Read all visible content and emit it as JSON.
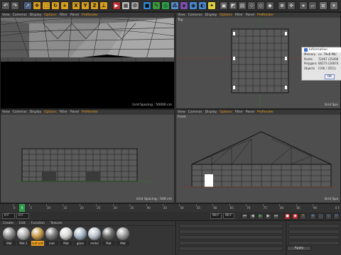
{
  "viewports": {
    "perspective": {
      "menus": [
        "View",
        "Cameras",
        "Display",
        "Options",
        "Filter",
        "Panel",
        "ProRender"
      ],
      "grid_spacing": "Grid Spacing : 50000 cm"
    },
    "top": {
      "menus": [
        "View",
        "Cameras",
        "Display",
        "Options",
        "Filter",
        "Panel",
        "ProRender"
      ],
      "name": "Top",
      "grid_spacing": "Grid Spa"
    },
    "right": {
      "menus": [
        "View",
        "Cameras",
        "Display",
        "Options",
        "Filter",
        "Panel",
        "ProRender"
      ],
      "grid_spacing": "Grid Spacing : 500 cm"
    },
    "front": {
      "menus": [
        "View",
        "Cameras",
        "Display",
        "Options",
        "Filter",
        "Panel",
        "ProRender"
      ],
      "name": "Front",
      "grid_spacing": "Grid Spa"
    }
  },
  "info_dialog": {
    "title": "Information",
    "rows": [
      {
        "key": "Memory",
        "value": "ca. 79x8 Mbi"
      },
      {
        "key": "Points",
        "value": "72467 (25490"
      },
      {
        "key": "Polygons",
        "value": "66573 (24874"
      },
      {
        "key": "Objects",
        "value": "(190 / 3551)"
      }
    ],
    "ok_label": "OK"
  },
  "timeline": {
    "ticks": [
      "0",
      "5",
      "10",
      "15",
      "20",
      "25",
      "30",
      "35",
      "40",
      "45",
      "50",
      "55",
      "60",
      "65",
      "70",
      "75",
      "80",
      "85",
      "90"
    ],
    "current_frame": "0",
    "end_label": "0 F"
  },
  "transport": {
    "start_field": "0 F",
    "min_field": "0 F",
    "end_field": "90 F",
    "max_field": "90 F"
  },
  "material_manager": {
    "menus": [
      "Create",
      "Edit",
      "Function",
      "Texture"
    ],
    "materials": [
      {
        "label": "Mat",
        "color": "#8a8a8a",
        "selected": false
      },
      {
        "label": "Mat.1",
        "color": "#b0b0b0",
        "selected": false
      },
      {
        "label": "roof.wall",
        "color": "#c89a4a",
        "selected": true
      },
      {
        "label": "mat",
        "color": "#7a7a7a",
        "selected": false
      },
      {
        "label": "Mat",
        "color": "#d8d8d8",
        "selected": false
      },
      {
        "label": "glass",
        "color": "#a6b8c8",
        "selected": false
      },
      {
        "label": "metal",
        "color": "#bcc4cc",
        "selected": false
      },
      {
        "label": "Mat",
        "color": "#6a6a6a",
        "selected": false
      },
      {
        "label": "Mat",
        "color": "#9c9c9c",
        "selected": false
      }
    ]
  },
  "attributes": {
    "apply_label": "Apply"
  }
}
